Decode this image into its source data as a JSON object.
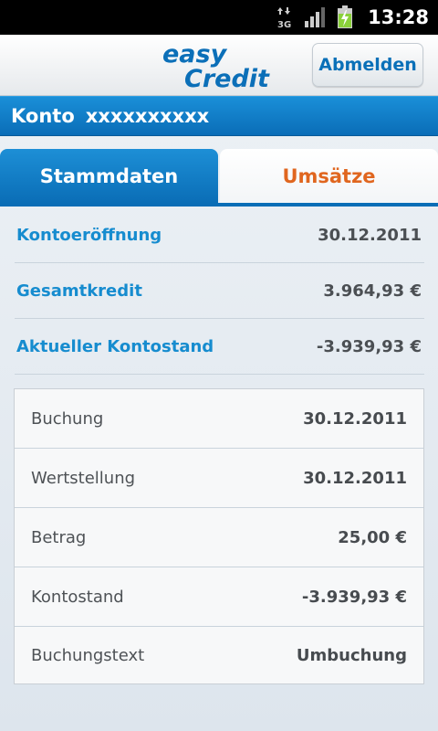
{
  "status_bar": {
    "network_label": "3G",
    "time": "13:28"
  },
  "header": {
    "logo_text_top": "easy",
    "logo_text_bottom": "Credit",
    "logout_label": "Abmelden"
  },
  "account": {
    "label": "Konto",
    "number": "xxxxxxxxxx"
  },
  "tabs": [
    {
      "label": "Stammdaten",
      "active": true
    },
    {
      "label": "Umsätze",
      "active": false
    }
  ],
  "summary": [
    {
      "label": "Kontoeröffnung",
      "value": "30.12.2011"
    },
    {
      "label": "Gesamtkredit",
      "value": "3.964,93 €"
    },
    {
      "label": "Aktueller Kontostand",
      "value": "-3.939,93 €"
    }
  ],
  "details": [
    {
      "label": "Buchung",
      "value": "30.12.2011"
    },
    {
      "label": "Wertstellung",
      "value": "30.12.2011"
    },
    {
      "label": "Betrag",
      "value": "25,00 €"
    },
    {
      "label": "Kontostand",
      "value": "-3.939,93 €"
    },
    {
      "label": "Buchungstext",
      "value": "Umbuchung"
    }
  ],
  "colors": {
    "brand_blue": "#0a6db7",
    "label_blue": "#168ccf",
    "tab_orange": "#e0661f"
  }
}
